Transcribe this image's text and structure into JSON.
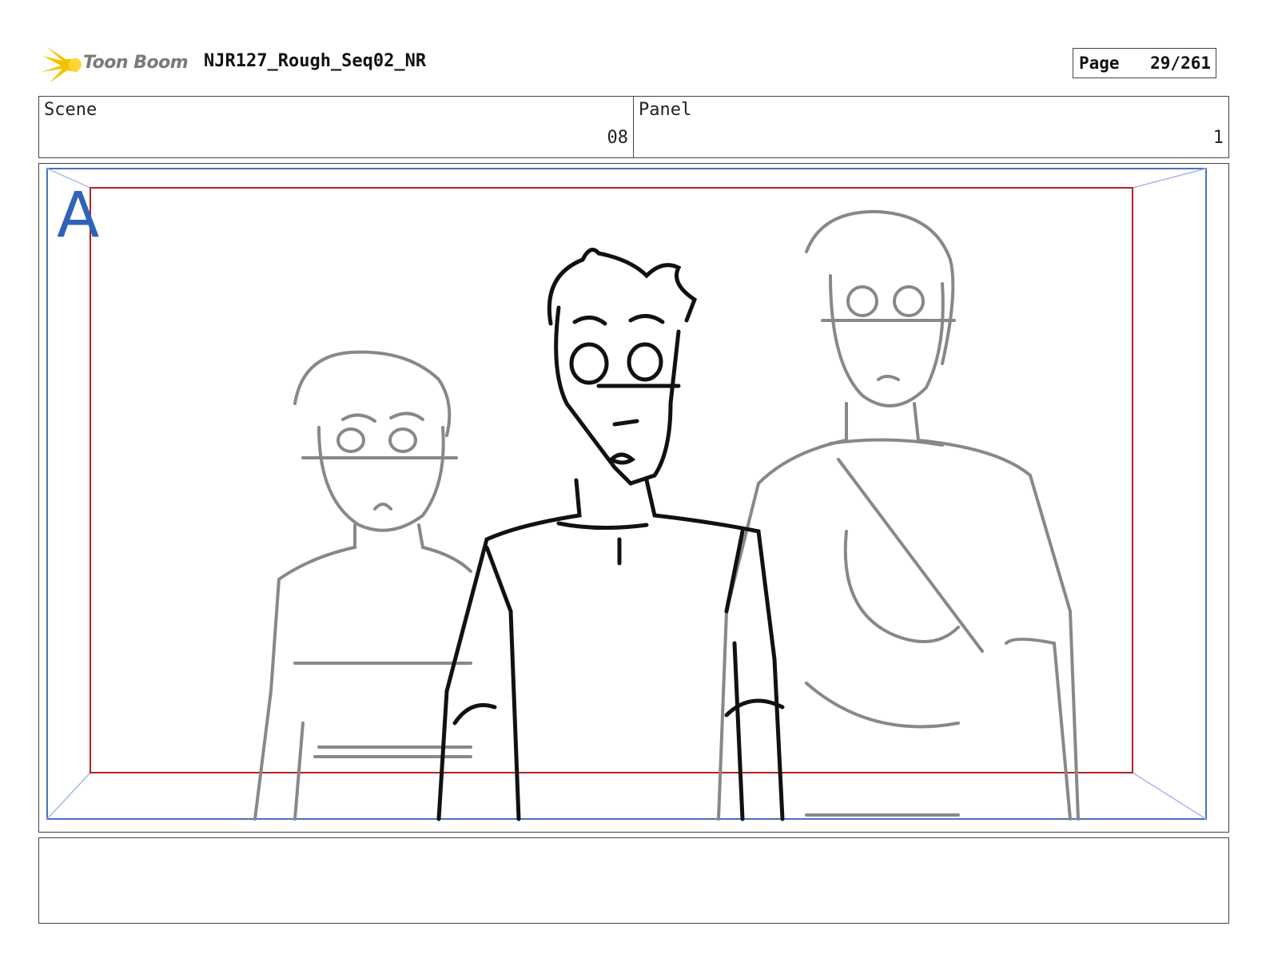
{
  "header": {
    "logo_text": "Toon Boom",
    "project_title": "NJR127_Rough_Seq02_NR",
    "page_label": "Page",
    "page_number": "29/261"
  },
  "info": {
    "scene_label": "Scene",
    "scene_value": "08",
    "panel_label": "Panel",
    "panel_value": "1"
  },
  "frame": {
    "camera_letter": "A",
    "colors": {
      "safe_frame": "#b22222",
      "camera_frame": "#4a72c4",
      "letter": "#2f63b8",
      "sketch_grey": "#888888",
      "sketch_black": "#111111"
    }
  },
  "notes": {}
}
